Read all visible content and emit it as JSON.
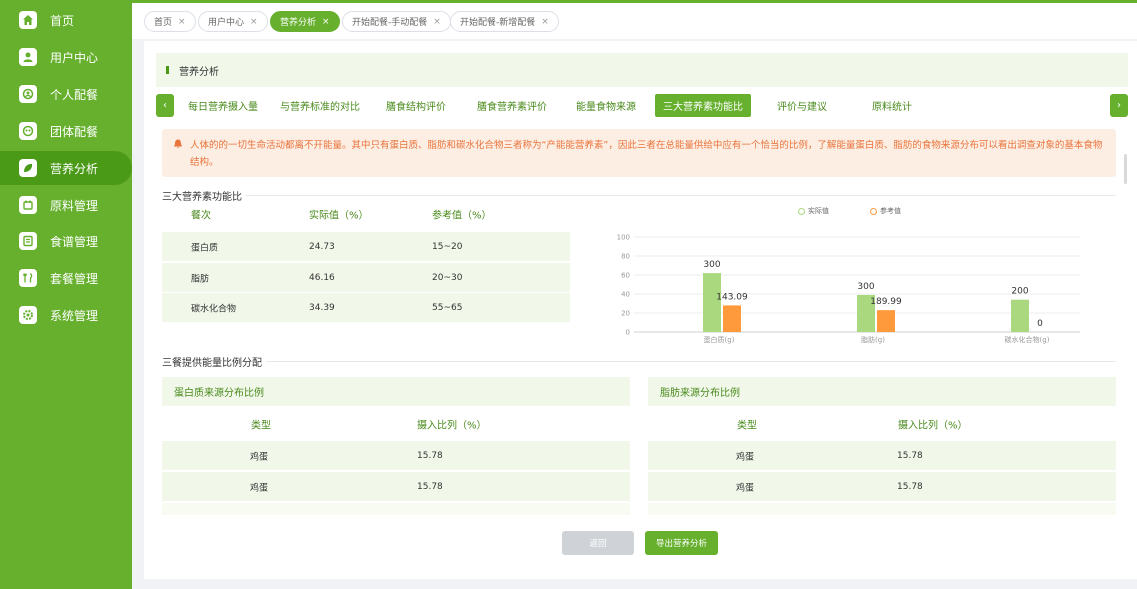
{
  "sidebar": {
    "items": [
      {
        "label": "首页",
        "icon": "home-icon",
        "active": false
      },
      {
        "label": "用户中心",
        "icon": "user-icon",
        "active": false
      },
      {
        "label": "个人配餐",
        "icon": "personal-meal-icon",
        "active": false
      },
      {
        "label": "团体配餐",
        "icon": "group-meal-icon",
        "active": false
      },
      {
        "label": "营养分析",
        "icon": "nutrition-icon",
        "active": true
      },
      {
        "label": "原料管理",
        "icon": "ingredient-icon",
        "active": false
      },
      {
        "label": "食谱管理",
        "icon": "recipe-icon",
        "active": false
      },
      {
        "label": "套餐管理",
        "icon": "package-icon",
        "active": false
      },
      {
        "label": "系统管理",
        "icon": "settings-icon",
        "active": false
      }
    ]
  },
  "tabs": [
    {
      "label": "首页",
      "active": false
    },
    {
      "label": "用户中心",
      "active": false
    },
    {
      "label": "营养分析",
      "active": true
    },
    {
      "label": "开始配餐-手动配餐",
      "active": false
    },
    {
      "label": "开始配餐-新增配餐",
      "active": false
    }
  ],
  "close_glyph": "×",
  "page_title": "营养分析",
  "subnav": {
    "prev_glyph": "‹",
    "next_glyph": "›",
    "items": [
      {
        "label": "每日营养摄入量",
        "active": false
      },
      {
        "label": "与营养标准的对比",
        "active": false
      },
      {
        "label": "膳食结构评价",
        "active": false
      },
      {
        "label": "膳食营养素评价",
        "active": false
      },
      {
        "label": "能量食物来源",
        "active": false
      },
      {
        "label": "三大营养素功能比",
        "active": true
      },
      {
        "label": "评价与建议",
        "active": false
      },
      {
        "label": "原料统计",
        "active": false
      }
    ]
  },
  "notice": {
    "text": "人体的的一切生命活动都离不开能量。其中只有蛋白质、脂肪和碳水化合物三者称为“产能能营养素”，因此三者在总能量供给中应有一个恰当的比例，了解能量蛋白质、脂肪的食物来源分布可以看出调查对象的基本食物结构。"
  },
  "ratio_section": {
    "title": "三大营养素功能比",
    "headers": [
      "餐次",
      "实际值（%）",
      "参考值（%）"
    ],
    "rows": [
      [
        "蛋白质",
        "24.73",
        "15~20"
      ],
      [
        "脂肪",
        "46.16",
        "20~30"
      ],
      [
        "碳水化合物",
        "34.39",
        "55~65"
      ]
    ]
  },
  "chart_data": {
    "type": "bar",
    "categories": [
      "蛋白质(g)",
      "脂肪(g)",
      "碳水化合物(g)"
    ],
    "series": [
      {
        "name": "实际值",
        "color": "#a9d87f",
        "values": [
          300,
          300,
          200
        ]
      },
      {
        "name": "参考值",
        "color": "#ff9a3c",
        "values": [
          143.09,
          189.99,
          0
        ]
      }
    ],
    "bar_heights": {
      "实际值": [
        62,
        39,
        34
      ],
      "参考值": [
        28,
        23,
        0
      ]
    },
    "ylim": [
      0,
      100
    ],
    "yticks": [
      0,
      20,
      40,
      60,
      80,
      100
    ],
    "legend_position": "top-right",
    "grid": true
  },
  "energy_section": {
    "title": "三餐提供能量比例分配"
  },
  "protein_panel": {
    "title": "蛋白质来源分布比例",
    "headers": [
      "类型",
      "摄入比列（%）"
    ],
    "rows": [
      [
        "鸡蛋",
        "15.78"
      ],
      [
        "鸡蛋",
        "15.78"
      ]
    ]
  },
  "fat_panel": {
    "title": "脂肪来源分布比例",
    "headers": [
      "类型",
      "摄入比列（%）"
    ],
    "rows": [
      [
        "鸡蛋",
        "15.78"
      ],
      [
        "鸡蛋",
        "15.78"
      ]
    ]
  },
  "buttons": {
    "back": "返回",
    "export": "导出营养分析"
  },
  "colors": {
    "primary": "#66b02e",
    "primary_dark": "#4a9a17",
    "light_bg": "#f1f8ea",
    "warning": "#e8743b"
  }
}
